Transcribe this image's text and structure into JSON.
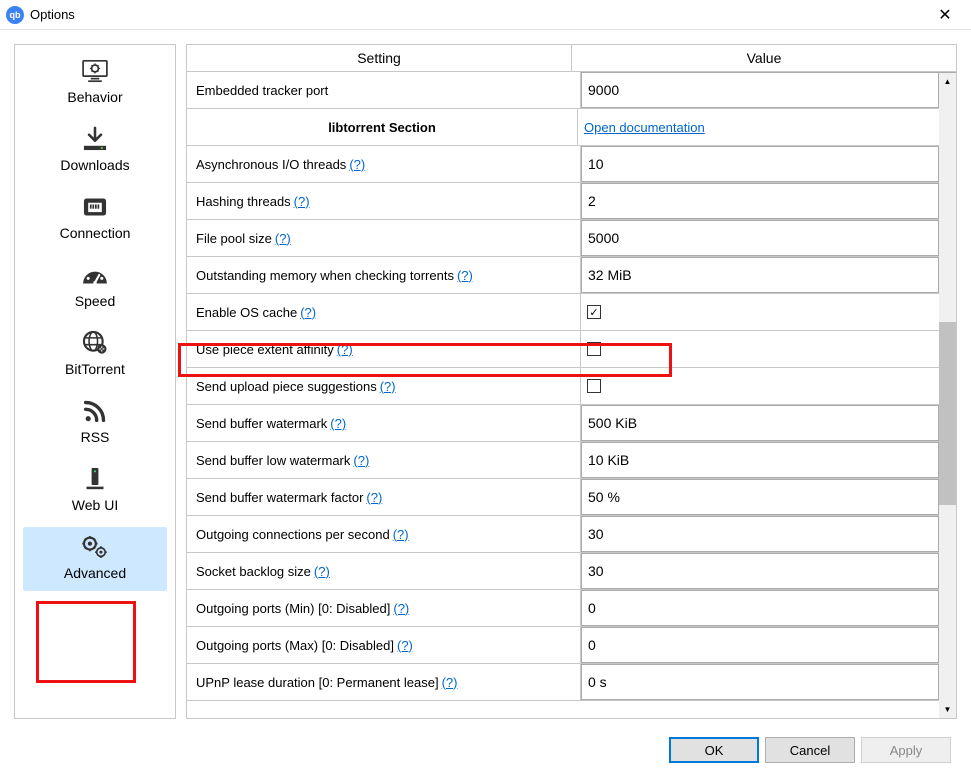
{
  "window": {
    "title": "Options"
  },
  "sidebar": {
    "items": [
      {
        "label": "Behavior"
      },
      {
        "label": "Downloads"
      },
      {
        "label": "Connection"
      },
      {
        "label": "Speed"
      },
      {
        "label": "BitTorrent"
      },
      {
        "label": "RSS"
      },
      {
        "label": "Web UI"
      },
      {
        "label": "Advanced"
      }
    ],
    "selected_index": 7
  },
  "table": {
    "headers": {
      "setting": "Setting",
      "value": "Value"
    },
    "section": {
      "title": "libtorrent Section",
      "link": "Open documentation"
    },
    "rows": [
      {
        "label": "Embedded tracker port",
        "help": false,
        "type": "spin",
        "value": "9000"
      },
      {
        "label": "Asynchronous I/O threads",
        "help": true,
        "type": "spin",
        "value": "10"
      },
      {
        "label": "Hashing threads",
        "help": true,
        "type": "spin",
        "value": "2"
      },
      {
        "label": "File pool size",
        "help": true,
        "type": "spin",
        "value": "5000"
      },
      {
        "label": "Outstanding memory when checking torrents",
        "help": true,
        "type": "spin",
        "value": "32 MiB"
      },
      {
        "label": "Enable OS cache",
        "help": true,
        "type": "check",
        "checked": true
      },
      {
        "label": "Use piece extent affinity",
        "help": true,
        "type": "check",
        "checked": false
      },
      {
        "label": "Send upload piece suggestions",
        "help": true,
        "type": "check",
        "checked": false
      },
      {
        "label": "Send buffer watermark",
        "help": true,
        "type": "spin",
        "value": "500 KiB"
      },
      {
        "label": "Send buffer low watermark",
        "help": true,
        "type": "spin",
        "value": "10 KiB"
      },
      {
        "label": "Send buffer watermark factor",
        "help": true,
        "type": "spin",
        "value": "50 %"
      },
      {
        "label": "Outgoing connections per second",
        "help": true,
        "type": "spin",
        "value": "30"
      },
      {
        "label": "Socket backlog size",
        "help": true,
        "type": "spin",
        "value": "30"
      },
      {
        "label": "Outgoing ports (Min) [0: Disabled]",
        "help": true,
        "type": "spin",
        "value": "0"
      },
      {
        "label": "Outgoing ports (Max) [0: Disabled]",
        "help": true,
        "type": "spin",
        "value": "0"
      },
      {
        "label": "UPnP lease duration [0: Permanent lease]",
        "help": true,
        "type": "spin",
        "value": "0 s"
      }
    ]
  },
  "footer": {
    "ok": "OK",
    "cancel": "Cancel",
    "apply": "Apply"
  },
  "help_text": "(?)"
}
